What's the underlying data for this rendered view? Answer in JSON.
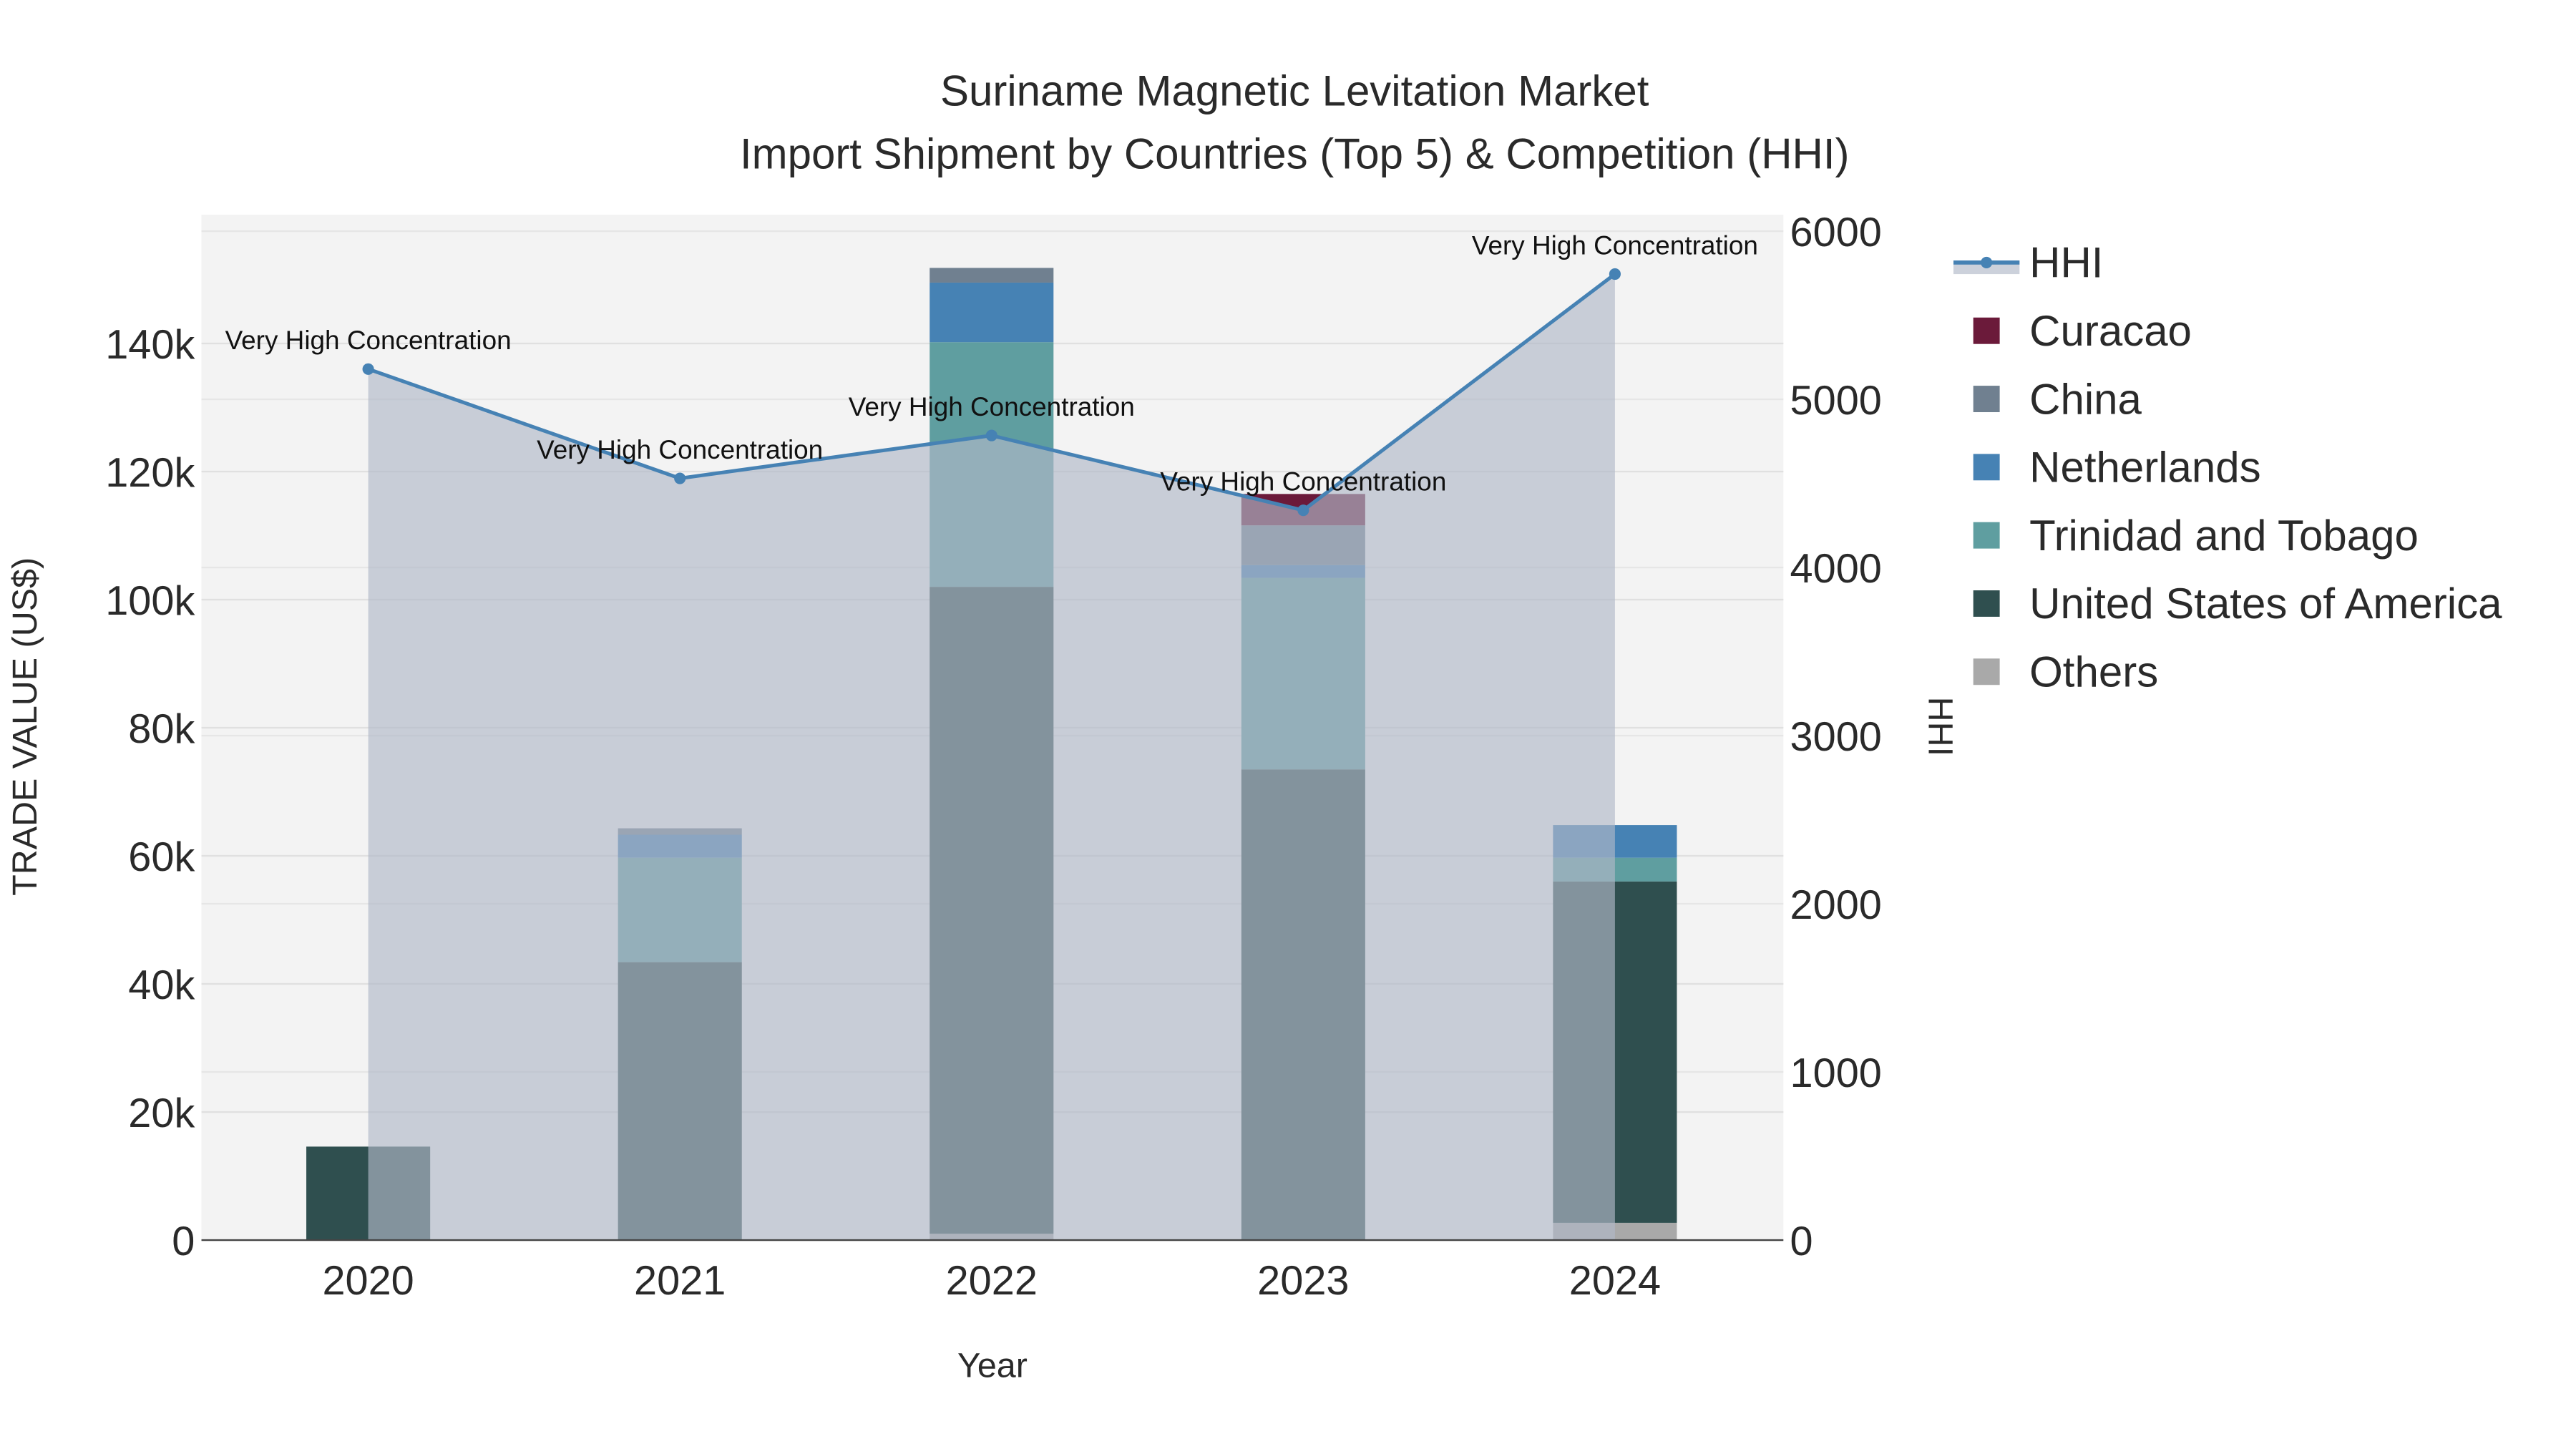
{
  "chart_data": {
    "type": "bar",
    "title_line1": "Suriname Magnetic Levitation Market",
    "title_line2": "Import Shipment by Countries (Top 5) & Competition (HHI)",
    "xlabel": "Year",
    "ylabel": "TRADE VALUE (US$)",
    "y2label": "HHI",
    "categories": [
      "2020",
      "2021",
      "2022",
      "2023",
      "2024"
    ],
    "ylim": [
      0,
      160000
    ],
    "y2lim": [
      0,
      6100
    ],
    "yticks": [
      0,
      20000,
      40000,
      60000,
      80000,
      100000,
      120000,
      140000
    ],
    "ytick_labels": [
      "0",
      "20k",
      "40k",
      "60k",
      "80k",
      "100k",
      "120k",
      "140k"
    ],
    "y2ticks": [
      0,
      1000,
      2000,
      3000,
      4000,
      5000,
      6000
    ],
    "y2tick_labels": [
      "0",
      "1000",
      "2000",
      "3000",
      "4000",
      "5000",
      "6000"
    ],
    "barmode": "stack",
    "series": [
      {
        "name": "Others",
        "color": "#a9a9a9",
        "values": [
          0,
          0,
          1000,
          0,
          2700
        ]
      },
      {
        "name": "United States of America",
        "color": "#2f4f4f",
        "values": [
          14600,
          43400,
          101000,
          73500,
          53300
        ]
      },
      {
        "name": "Trinidad and Tobago",
        "color": "#5f9ea0",
        "values": [
          0,
          16300,
          38200,
          29900,
          3700
        ]
      },
      {
        "name": "Netherlands",
        "color": "#4682b4",
        "values": [
          0,
          3600,
          9300,
          2000,
          5100
        ]
      },
      {
        "name": "China",
        "color": "#708090",
        "values": [
          0,
          1000,
          2300,
          6200,
          0
        ]
      },
      {
        "name": "Curacao",
        "color": "#6b1a3a",
        "values": [
          0,
          0,
          0,
          4900,
          0
        ]
      }
    ],
    "hhi": {
      "name": "HHI",
      "color": "#4682b4",
      "values": [
        5180,
        4530,
        4785,
        4340,
        5745
      ]
    },
    "annotations": [
      "Very High Concentration",
      "Very High Concentration",
      "Very High Concentration",
      "Very High Concentration",
      "Very High Concentration"
    ],
    "legend_order": [
      "HHI",
      "Curacao",
      "China",
      "Netherlands",
      "Trinidad and Tobago",
      "United States of America",
      "Others"
    ],
    "legend_position": "right",
    "grid": true
  }
}
